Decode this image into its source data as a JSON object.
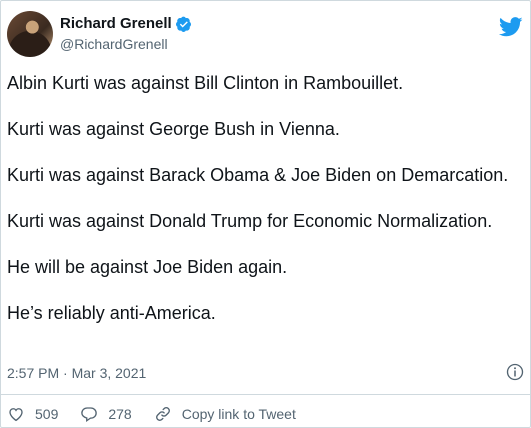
{
  "tweet": {
    "author": {
      "name": "Richard Grenell",
      "handle": "@RichardGrenell",
      "verified": true
    },
    "paragraphs": [
      "Albin Kurti was against Bill Clinton in Rambouillet.",
      "Kurti was against George Bush in Vienna.",
      "Kurti was against Barack Obama & Joe Biden on Demarcation.",
      "Kurti was against Donald Trump for Economic Normalization.",
      "He will be against Joe Biden again.",
      "He’s reliably anti-America."
    ],
    "timestamp": "2:57 PM · Mar 3, 2021",
    "likes": "509",
    "replies": "278",
    "copy_link_label": "Copy link to Tweet"
  },
  "colors": {
    "accent": "#1d9bf0",
    "text": "#0f1419",
    "muted": "#536471",
    "border": "#cfd9de"
  },
  "icons": [
    "verified-badge-icon",
    "twitter-bird-icon",
    "info-icon",
    "heart-icon",
    "reply-icon",
    "link-icon"
  ]
}
